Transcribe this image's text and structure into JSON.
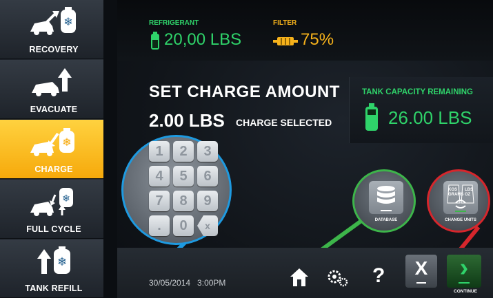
{
  "sidebar": {
    "items": [
      {
        "label": "RECOVERY",
        "active": false
      },
      {
        "label": "EVACUATE",
        "active": false
      },
      {
        "label": "CHARGE",
        "active": true
      },
      {
        "label": "FULL CYCLE",
        "active": false
      },
      {
        "label": "TANK REFILL",
        "active": false
      }
    ]
  },
  "status": {
    "refrigerant_label": "REFRIGERANT",
    "refrigerant_value": "20,00 LBS",
    "filter_label": "FILTER",
    "filter_value": "75%"
  },
  "charge": {
    "title": "SET CHARGE AMOUNT",
    "amount": "2.00 LBS",
    "selected_label": "CHARGE SELECTED"
  },
  "tank": {
    "label": "TANK CAPACITY REMAINING",
    "value": "26.00 LBS"
  },
  "keypad": {
    "keys": [
      "1",
      "2",
      "3",
      "4",
      "5",
      "6",
      "7",
      "8",
      "9",
      ".",
      "0"
    ],
    "clear_glyph": "x"
  },
  "features": {
    "database_label": "DATABASE",
    "units_label": "CHANGE UNITS",
    "units_left": "KGS\nGRAMS",
    "units_right": "LBS\nOZ"
  },
  "footer": {
    "datetime": "30/05/2014   3:00PM",
    "help_glyph": "?",
    "cancel_glyph": "X",
    "continue_glyph": "›",
    "continue_label": "CONTINUE"
  },
  "colors": {
    "accent_yellow": "#f6b21b",
    "green": "#2fd36a",
    "blue_callout": "#1e9ae0",
    "green_callout": "#3db54a",
    "red_callout": "#d6262c"
  }
}
